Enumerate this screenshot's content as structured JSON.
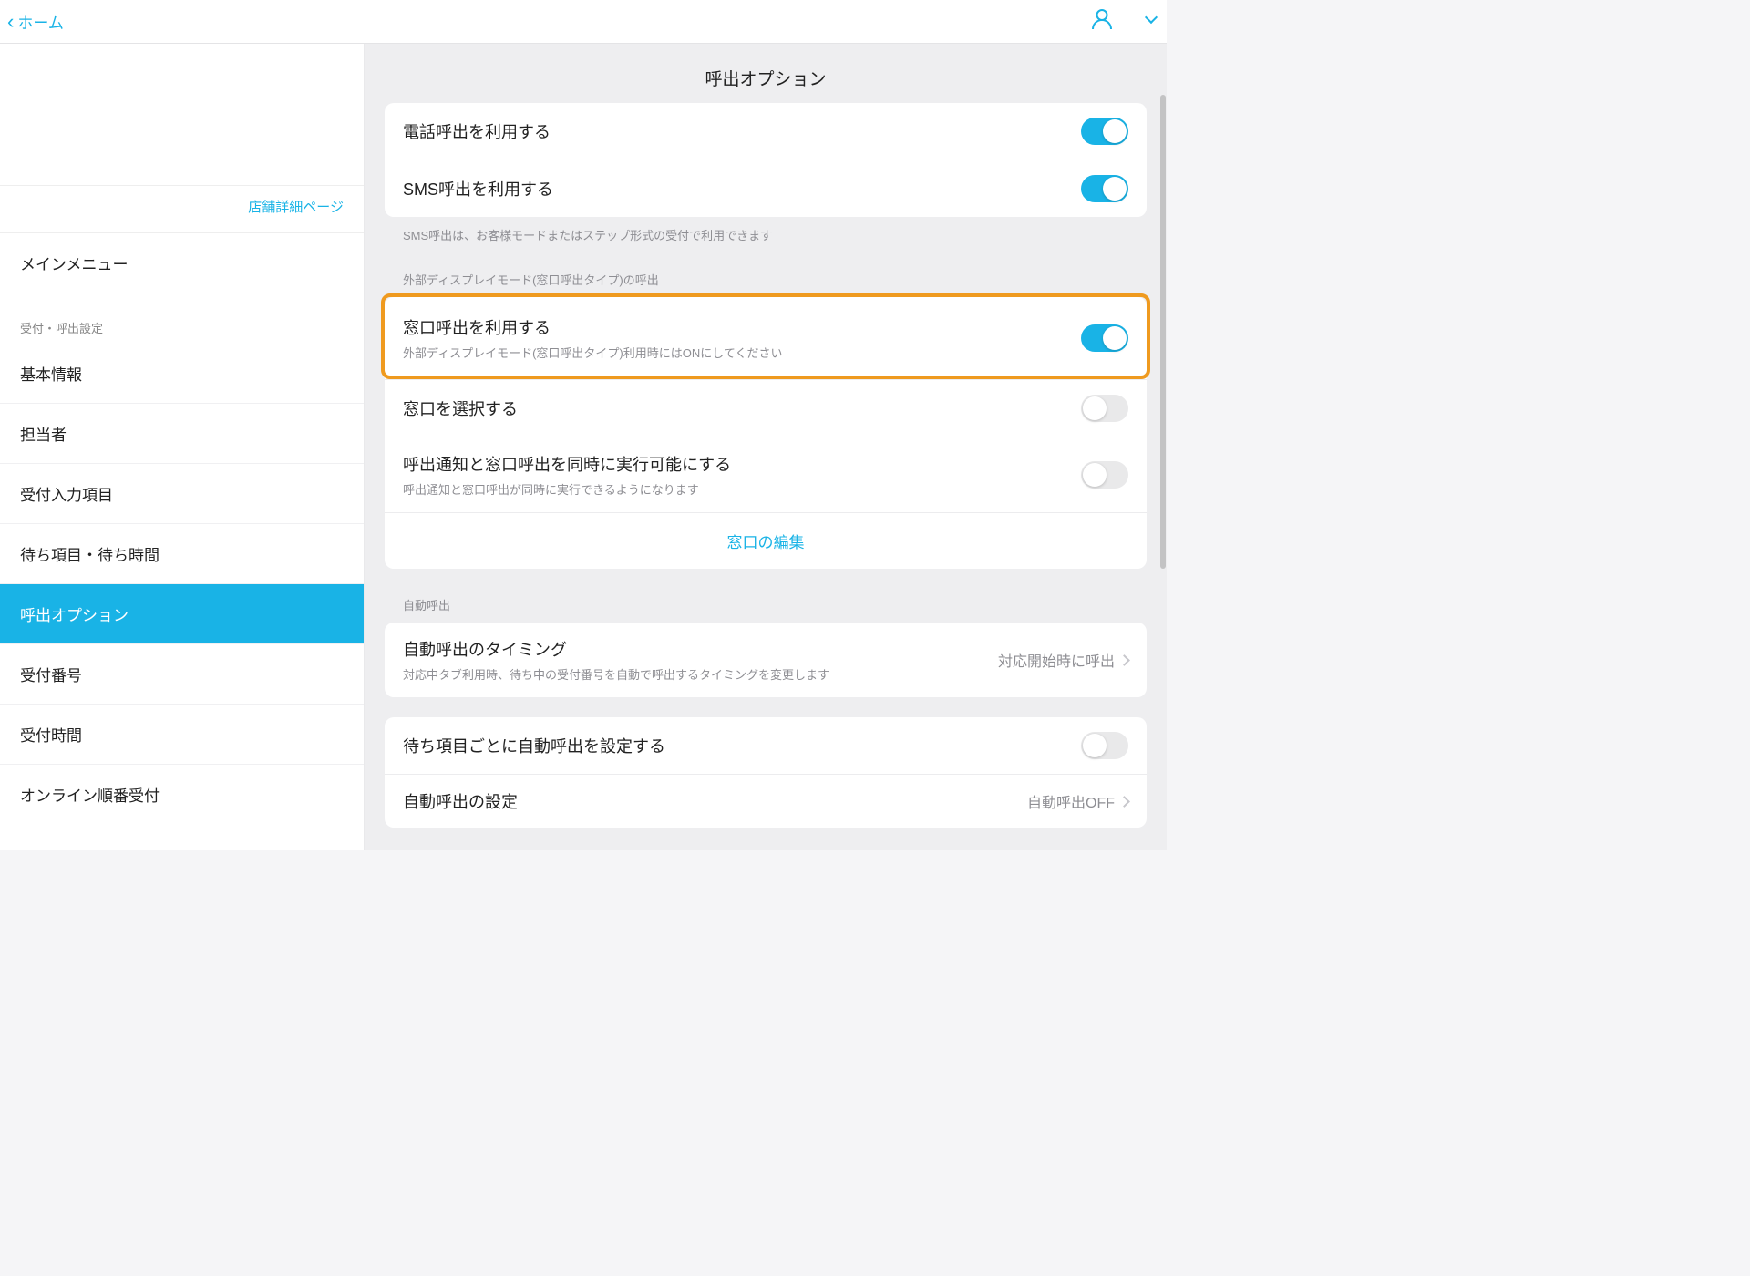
{
  "header": {
    "back": "ホーム"
  },
  "sidebar": {
    "store_link": "店舗詳細ページ",
    "main_menu": "メインメニュー",
    "settings_label": "受付・呼出設定",
    "items": [
      "基本情報",
      "担当者",
      "受付入力項目",
      "待ち項目・待ち時間",
      "呼出オプション",
      "受付番号",
      "受付時間",
      "オンライン順番受付"
    ],
    "active_index": 4
  },
  "main": {
    "title": "呼出オプション",
    "group1": {
      "rows": [
        {
          "title": "電話呼出を利用する",
          "toggle": true
        },
        {
          "title": "SMS呼出を利用する",
          "toggle": true
        }
      ],
      "hint": "SMS呼出は、お客様モードまたはステップ形式の受付で利用できます"
    },
    "group2": {
      "label": "外部ディスプレイモード(窓口呼出タイプ)の呼出",
      "rows": [
        {
          "title": "窓口呼出を利用する",
          "sub": "外部ディスプレイモード(窓口呼出タイプ)利用時にはONにしてください",
          "toggle": true
        },
        {
          "title": "窓口を選択する",
          "toggle": false
        },
        {
          "title": "呼出通知と窓口呼出を同時に実行可能にする",
          "sub": "呼出通知と窓口呼出が同時に実行できるようになります",
          "toggle": false
        }
      ],
      "link": "窓口の編集"
    },
    "group3": {
      "label": "自動呼出",
      "rows": [
        {
          "title": "自動呼出のタイミング",
          "sub": "対応中タブ利用時、待ち中の受付番号を自動で呼出するタイミングを変更します",
          "value": "対応開始時に呼出"
        }
      ]
    },
    "group4": {
      "rows": [
        {
          "title": "待ち項目ごとに自動呼出を設定する",
          "toggle": false
        },
        {
          "title": "自動呼出の設定",
          "value": "自動呼出OFF"
        }
      ]
    }
  }
}
